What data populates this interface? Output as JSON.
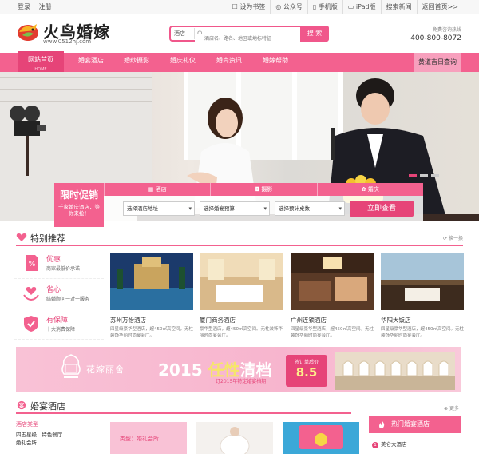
{
  "topbar": {
    "left": [
      "登录",
      "注册"
    ],
    "right": [
      "设为书签",
      "公众号",
      "手机版",
      "iPad版",
      "搜索新闻",
      "返回首页>>"
    ]
  },
  "header": {
    "brand": "火鸟婚嫁",
    "url": "www.0512hj.com",
    "search": {
      "category": "酒店",
      "placeholder": "酒店名、路名、地区或地标特征",
      "button": "搜 索"
    },
    "hotline_label": "免费咨询热线",
    "hotline": "400-800-8072"
  },
  "nav": {
    "items": [
      {
        "label": "网站首页",
        "sub": "HOME"
      },
      {
        "label": "婚宴酒店"
      },
      {
        "label": "婚纱摄影"
      },
      {
        "label": "婚庆礼仪"
      },
      {
        "label": "婚尚资讯"
      },
      {
        "label": "婚嫁帮助"
      }
    ],
    "right": "黄道吉日查询"
  },
  "promo": {
    "title": "限时促销",
    "desc": "千家婚庆酒店，等你来抢！",
    "tabs": [
      "酒店",
      "摄影",
      "婚庆"
    ],
    "selects": [
      "选择酒店地址",
      "选择婚宴预算",
      "选择预计桌数"
    ],
    "button": "立即查看"
  },
  "special": {
    "title": "特别推荐",
    "more": "换一换",
    "features": [
      {
        "title": "优惠",
        "desc": "商家最低价承诺"
      },
      {
        "title": "省心",
        "desc": "结婚顾问一对一服务"
      },
      {
        "title": "有保障",
        "desc": "十大消费保障"
      }
    ],
    "hotels": [
      {
        "name": "苏州万怡酒店",
        "desc": "四星级豪华型酒店，超450㎡高空间，无柱装饰华丽时尚宴会厅。"
      },
      {
        "name": "厦门商务酒店",
        "desc": "豪华型酒店，超450㎡高空间。无柱装饰华丽时尚宴会厅。"
      },
      {
        "name": "广州连锁酒店",
        "desc": "四星级豪华型酒店，超450㎡高空间。无柱装饰华丽时尚宴会厅。"
      },
      {
        "name": "华阳大饭店",
        "desc": "四星级豪华型酒店，超450㎡高空间。无柱装饰华丽时尚宴会厅。"
      }
    ]
  },
  "ad": {
    "brand": "花嫁丽舍",
    "slogan_year": "2015",
    "slogan_key": "任性",
    "slogan_tail": "清档",
    "sub": "订2015年特定婚宴档期",
    "cert_label": "签订单后价",
    "cert_value": "8.5"
  },
  "banquet": {
    "title": "婚宴酒店",
    "more": "更多",
    "left_title": "酒店类型",
    "left_values": [
      "四五星级",
      "特色餐厅",
      "婚礼会所"
    ],
    "img_label": "类型：婚礼会所",
    "hot_title": "热门婚宴酒店",
    "hot_list": [
      {
        "rank": "1",
        "name": "美仑大酒店"
      }
    ]
  },
  "colors": {
    "brand": "#f3618f",
    "brand_dark": "#e64478"
  }
}
